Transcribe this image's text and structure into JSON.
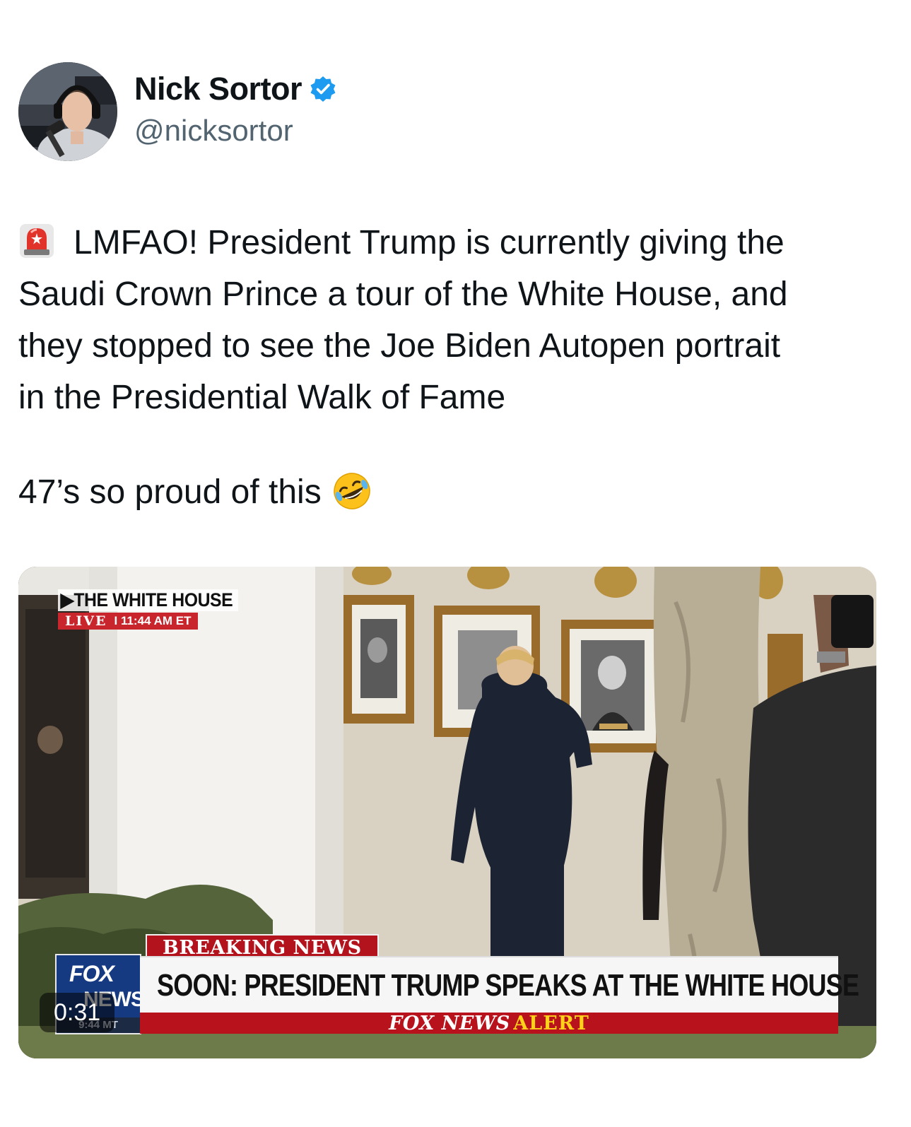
{
  "author": {
    "display_name": "Nick Sortor",
    "handle": "@nicksortor",
    "verified": true,
    "avatar_icon": "profile-photo",
    "verified_icon": "verified-badge-icon",
    "verified_color": "#1d9bf0"
  },
  "tweet": {
    "lines": [
      "LMFAO! President Trump is currently giving the",
      "Saudi Crown Prince a tour of the White House, and",
      "they stopped to see the Joe Biden Autopen portrait",
      "in the Presidential Walk of Fame"
    ],
    "followup": "47’s so proud of this",
    "lead_emoji": "rotating-light-icon",
    "trail_emoji": "rolling-on-floor-laughing-icon"
  },
  "video": {
    "duration": "0:31",
    "overlay": {
      "location_title": "THE WHITE HOUSE",
      "live_label": "LIVE",
      "live_time": "11:44 AM ET",
      "breaking_label": "BREAKING NEWS",
      "headline": "SOON: PRESIDENT TRUMP SPEAKS AT THE WHITE HOUSE",
      "alert_prefix": "FOX NEWS",
      "alert_word": "ALERT",
      "network_logo_top": "FOX",
      "network_logo_bottom": "NEWS",
      "network_clock": "9:44 MT"
    }
  },
  "colors": {
    "text": "#0f1419",
    "secondary_text": "#536471",
    "breaking_red": "#b3131d",
    "fox_blue": "#163a82",
    "alert_yellow": "#ffd21a"
  }
}
